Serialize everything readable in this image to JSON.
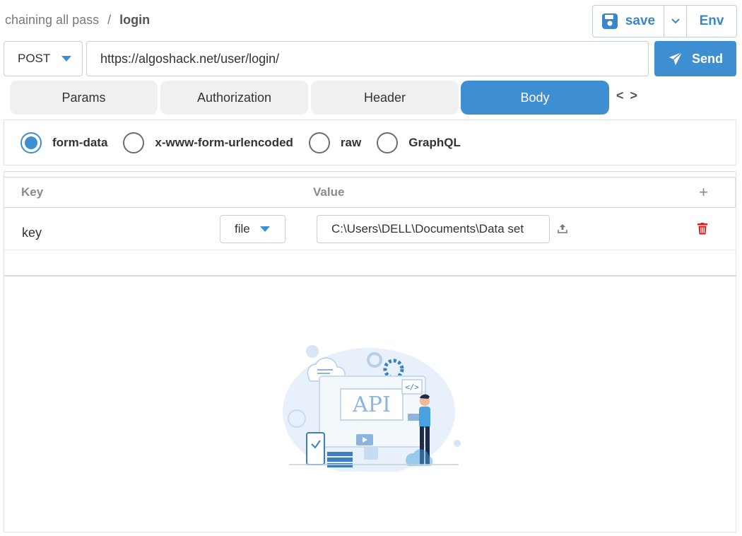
{
  "breadcrumb": {
    "collection": "chaining all pass",
    "separator": "/",
    "request": "login"
  },
  "toolbar": {
    "save_label": "save",
    "env_label": "Env"
  },
  "request": {
    "method": "POST",
    "url": "https://algoshack.net/user/login/",
    "send_label": "Send"
  },
  "tabs": [
    {
      "label": "Params",
      "active": false
    },
    {
      "label": "Authorization",
      "active": false
    },
    {
      "label": "Header",
      "active": false
    },
    {
      "label": "Body",
      "active": true
    }
  ],
  "code_toggle": "< >",
  "body_types": [
    {
      "label": "form-data",
      "checked": true
    },
    {
      "label": "x-www-form-urlencoded",
      "checked": false
    },
    {
      "label": "raw",
      "checked": false
    },
    {
      "label": "GraphQL",
      "checked": false
    }
  ],
  "table": {
    "headers": {
      "key": "Key",
      "value": "Value",
      "add": "+"
    },
    "rows": [
      {
        "key": "key",
        "type": "file",
        "value": "C:\\Users\\DELL\\Documents\\Data set"
      }
    ]
  },
  "illustration": {
    "text": "API"
  },
  "colors": {
    "accent": "#3d8fd1",
    "danger": "#e02020",
    "border": "#cfcfcf",
    "tab_bg": "#f0f0f0"
  },
  "icons": {
    "save": "floppy-disk-icon",
    "dropdown": "chevron-down-icon",
    "send": "paper-plane-icon",
    "upload": "upload-icon",
    "delete": "trash-icon",
    "add": "plus-icon",
    "code": "code-icon"
  }
}
